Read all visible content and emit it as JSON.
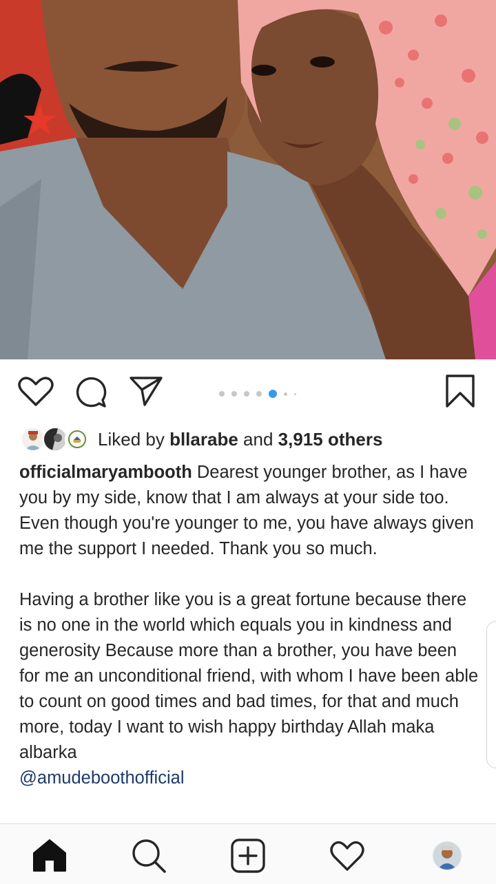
{
  "post": {
    "photo_alt": "Selfie of the poster with her younger brother",
    "carousel": {
      "count": 6,
      "active_index": 4
    }
  },
  "likes": {
    "prefix": "Liked by",
    "user": "bllarabe",
    "and": "and",
    "count_text": "3,915 others"
  },
  "caption": {
    "username": "officialmaryambooth",
    "paragraph1": "Dearest younger brother, as I have you by my side, know that I am always at your side too. Even though you're younger to me, you have always given me the support I needed. Thank you so much.",
    "paragraph2": "Having a brother like you is a great fortune because there is no one in the world which equals you in kindness and generosity Because more than a brother, you have been for me an unconditional friend, with whom I have been able to count on good times and bad times, for that and much more, today I want to wish happy birthday Allah maka albarka",
    "mention": "@amudeboothofficial"
  },
  "icons": {
    "like": "heart-outline-icon",
    "comment": "comment-bubble-icon",
    "share": "paper-plane-icon",
    "save": "bookmark-icon",
    "home": "home-filled-icon",
    "search": "search-icon",
    "new_post": "plus-square-icon",
    "activity": "heart-outline-icon"
  },
  "colors": {
    "text": "#262626",
    "mention": "#1d3a6b",
    "carousel_active": "#3897f0",
    "carousel_inactive": "#c7c7c7",
    "nav_background": "#fafafa"
  }
}
